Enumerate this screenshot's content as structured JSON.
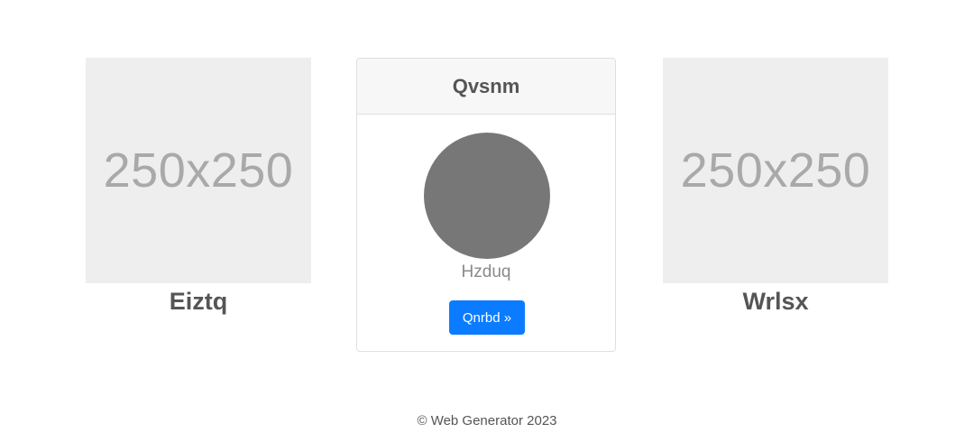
{
  "left_tile": {
    "placeholder_text": "250x250",
    "caption": "Eiztq"
  },
  "center_card": {
    "title": "Qvsnm",
    "subtitle": "Hzduq",
    "button_label": "Qnrbd »"
  },
  "right_tile": {
    "placeholder_text": "250x250",
    "caption": "Wrlsx"
  },
  "footer": {
    "copyright": "© Web Generator 2023"
  },
  "colors": {
    "placeholder_bg": "#eeeeee",
    "placeholder_text": "#a9a9a9",
    "avatar": "#777777",
    "button_bg": "#0b7cff",
    "card_header_bg": "#f7f7f7",
    "text_dark": "#555555"
  }
}
